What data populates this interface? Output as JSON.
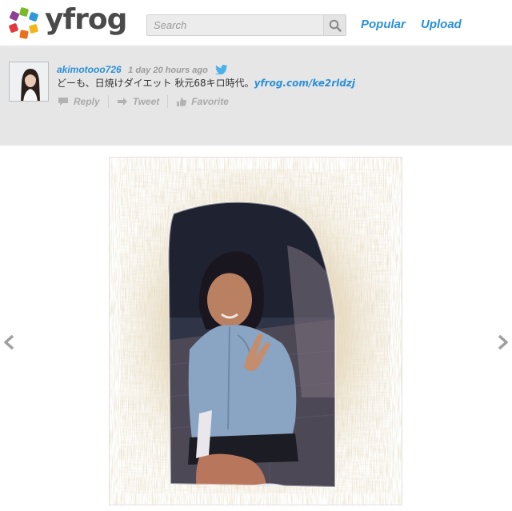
{
  "header": {
    "logo_text": "yfrog",
    "search": {
      "placeholder": "Search",
      "value": ""
    },
    "nav": {
      "popular": "Popular",
      "upload": "Upload"
    }
  },
  "tweet": {
    "username": "akimotooo726",
    "timestamp": "1 day 20 hours ago",
    "text": "どーも、日焼けダイエット 秋元68キロ時代。",
    "link": "yfrog.com/ke2rldzj",
    "actions": {
      "reply": "Reply",
      "tweet": "Tweet",
      "favorite": "Favorite"
    }
  },
  "colors": {
    "accent": "#2b8fd6",
    "panel_bg": "#e6e6e6",
    "logo_text": "#4a4a4a"
  },
  "icons": [
    "yfrog-logo-icon",
    "search-icon",
    "twitter-bird-icon",
    "reply-icon",
    "retweet-icon",
    "favorite-icon",
    "chevron-left-icon",
    "chevron-right-icon"
  ]
}
